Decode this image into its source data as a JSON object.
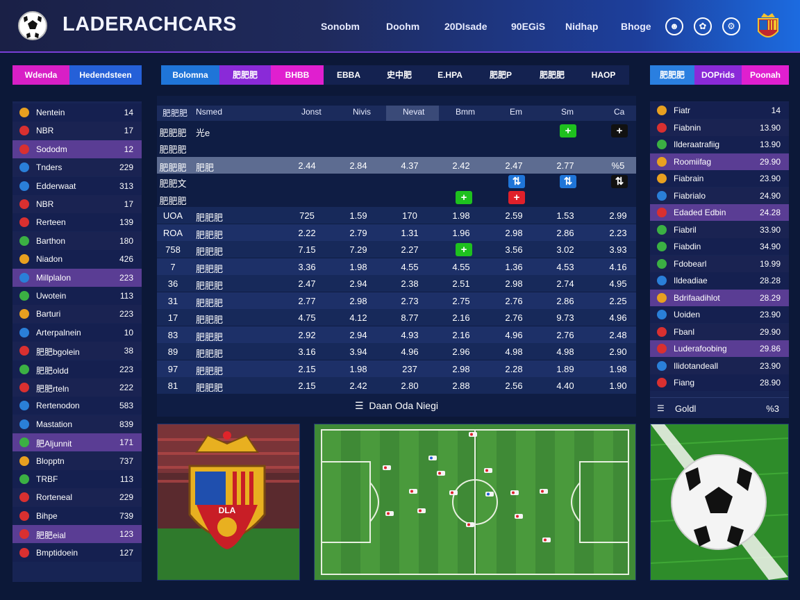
{
  "header": {
    "brand": "LADERACHCARS",
    "nav": [
      "Sonobm",
      "Doohm",
      "20DIsade",
      "90EGiS",
      "Nidhap",
      "Bhoge"
    ],
    "icons": [
      "person-icon",
      "cyclist-icon",
      "bike-icon"
    ]
  },
  "left_tabs": [
    "Wdenda",
    "Hedendsteen"
  ],
  "center_tabs": [
    "Bolomna",
    "肥肥肥",
    "BHBB",
    "EBBA",
    "史中肥",
    "E.HPA",
    "肥肥P",
    "肥肥肥",
    "HAOP"
  ],
  "right_tabs": [
    "肥肥肥",
    "DOPrids",
    "Poonah"
  ],
  "left_list": [
    {
      "name": "Nentein",
      "value": "14",
      "color": "#e8a020"
    },
    {
      "name": "NBR",
      "value": "17",
      "color": "#d93030"
    },
    {
      "name": "Sododm",
      "value": "12",
      "color": "#d93030"
    },
    {
      "name": "Tnders",
      "value": "229",
      "color": "#2a7fd8"
    },
    {
      "name": "Edderwaat",
      "value": "313",
      "color": "#2a7fd8"
    },
    {
      "name": "NBR",
      "value": "17",
      "color": "#d93030"
    },
    {
      "name": "Rerteen",
      "value": "139",
      "color": "#d93030"
    },
    {
      "name": "Barthon",
      "value": "180",
      "color": "#3bb043"
    },
    {
      "name": "Niadon",
      "value": "426",
      "color": "#e8a020"
    },
    {
      "name": "Millplalon",
      "value": "223",
      "color": "#2a7fd8"
    },
    {
      "name": "Uwotein",
      "value": "113",
      "color": "#3bb043"
    },
    {
      "name": "Barturi",
      "value": "223",
      "color": "#e8a020"
    },
    {
      "name": "Arterpalnein",
      "value": "10",
      "color": "#2a7fd8"
    },
    {
      "name": "肥肥bgolein",
      "value": "38",
      "color": "#d93030"
    },
    {
      "name": "肥肥oldd",
      "value": "223",
      "color": "#3bb043"
    },
    {
      "name": "肥肥rteln",
      "value": "222",
      "color": "#d93030"
    },
    {
      "name": "Rertenodon",
      "value": "583",
      "color": "#2a7fd8"
    },
    {
      "name": "Mastation",
      "value": "839",
      "color": "#2a7fd8"
    },
    {
      "name": "肥Aljunnit",
      "value": "171",
      "color": "#3bb043"
    },
    {
      "name": "Blopptn",
      "value": "737",
      "color": "#e8a020"
    },
    {
      "name": "TRBF",
      "value": "113",
      "color": "#3bb043"
    },
    {
      "name": "Rorteneal",
      "value": "229",
      "color": "#d93030"
    },
    {
      "name": "Bihpe",
      "value": "739",
      "color": "#d93030"
    },
    {
      "name": "肥肥eial",
      "value": "123",
      "color": "#d93030"
    },
    {
      "name": "Bmptidoein",
      "value": "127",
      "color": "#d93030"
    }
  ],
  "table": {
    "headers": [
      "肥肥肥",
      "Nsmed",
      "Jonst",
      "Nivis",
      "Nevat",
      "Bmm",
      "Em",
      "Sm",
      "Ca"
    ],
    "rows": [
      {
        "id": "肥肥肥",
        "name": "光e",
        "values": []
      },
      {
        "id": "肥肥肥",
        "name": "",
        "values": []
      },
      {
        "id": "肥肥肥",
        "name": "肥肥",
        "values": [
          "2.44",
          "2.84",
          "4.37",
          "2.42",
          "2.47",
          "2.77",
          "%5"
        ]
      },
      {
        "id": "肥肥文",
        "name": "",
        "values": []
      },
      {
        "id": "肥肥肥",
        "name": "",
        "values": []
      },
      {
        "id": "UOA",
        "name": "肥肥肥",
        "values": [
          "725",
          "1.59",
          "170",
          "1.98",
          "2.59",
          "1.53",
          "2.99"
        ]
      },
      {
        "id": "ROA",
        "name": "肥肥肥",
        "values": [
          "2.22",
          "2.79",
          "1.31",
          "1.96",
          "2.98",
          "2.86",
          "2.23"
        ]
      },
      {
        "id": "758",
        "name": "肥肥肥",
        "values": [
          "7.15",
          "7.29",
          "2.27",
          "",
          "3.56",
          "3.02",
          "3.93"
        ]
      },
      {
        "id": "7",
        "name": "肥肥肥",
        "values": [
          "3.36",
          "1.98",
          "4.55",
          "4.55",
          "1.36",
          "4.53",
          "4.16"
        ]
      },
      {
        "id": "36",
        "name": "肥肥肥",
        "values": [
          "2.47",
          "2.94",
          "2.38",
          "2.51",
          "2.98",
          "2.74",
          "4.95"
        ]
      },
      {
        "id": "31",
        "name": "肥肥肥",
        "values": [
          "2.77",
          "2.98",
          "2.73",
          "2.75",
          "2.76",
          "2.86",
          "2.25"
        ]
      },
      {
        "id": "17",
        "name": "肥肥肥",
        "values": [
          "4.75",
          "4.12",
          "8.77",
          "2.16",
          "2.76",
          "9.73",
          "4.96"
        ]
      },
      {
        "id": "83",
        "name": "肥肥肥",
        "values": [
          "2.92",
          "2.94",
          "4.93",
          "2.16",
          "4.96",
          "2.76",
          "2.48"
        ]
      },
      {
        "id": "89",
        "name": "肥肥肥",
        "values": [
          "3.16",
          "3.94",
          "4.96",
          "2.96",
          "4.98",
          "4.98",
          "2.90"
        ]
      },
      {
        "id": "97",
        "name": "肥肥肥",
        "values": [
          "2.15",
          "1.98",
          "237",
          "2.98",
          "2.28",
          "1.89",
          "1.98"
        ]
      },
      {
        "id": "81",
        "name": "肥肥肥",
        "values": [
          "2.15",
          "2.42",
          "2.80",
          "2.88",
          "2.56",
          "4.40",
          "1.90"
        ]
      }
    ],
    "footer": "Daan Oda Niegi"
  },
  "right_list": [
    {
      "name": "Fiatr",
      "value": "14",
      "color": "#e8a020"
    },
    {
      "name": "Fiabnin",
      "value": "13.90",
      "color": "#d93030"
    },
    {
      "name": "Ilderaatrafiig",
      "value": "13.90",
      "color": "#3bb043"
    },
    {
      "name": "Roomiifag",
      "value": "29.90",
      "color": "#e8a020"
    },
    {
      "name": "Fiabrain",
      "value": "23.90",
      "color": "#e8a020"
    },
    {
      "name": "Fiabrialo",
      "value": "24.90",
      "color": "#2a7fd8"
    },
    {
      "name": "Edaded Edbin",
      "value": "24.28",
      "color": "#d93030"
    },
    {
      "name": "Fiabril",
      "value": "33.90",
      "color": "#3bb043"
    },
    {
      "name": "Fiabdin",
      "value": "34.90",
      "color": "#3bb043"
    },
    {
      "name": "Fdobearl",
      "value": "19.99",
      "color": "#3bb043"
    },
    {
      "name": "Ildeadiae",
      "value": "28.28",
      "color": "#2a7fd8"
    },
    {
      "name": "Bdrifaadihlot",
      "value": "28.29",
      "color": "#e8a020"
    },
    {
      "name": "Uoiden",
      "value": "23.90",
      "color": "#2a7fd8"
    },
    {
      "name": "Fbanl",
      "value": "29.90",
      "color": "#d93030"
    },
    {
      "name": "Luderafoobing",
      "value": "29.86",
      "color": "#d93030"
    },
    {
      "name": "Ilidotandeall",
      "value": "23.90",
      "color": "#2a7fd8"
    },
    {
      "name": "Fiang",
      "value": "28.90",
      "color": "#d93030"
    }
  ],
  "right_footer": {
    "label": "Goldl",
    "value": "%3"
  },
  "crest": {
    "text": "DLA"
  }
}
